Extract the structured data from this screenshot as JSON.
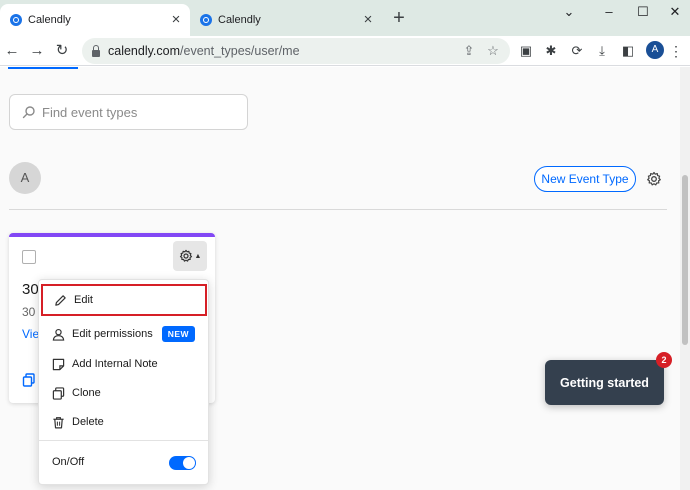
{
  "browser": {
    "tabs": [
      {
        "title": "Calendly"
      },
      {
        "title": "Calendly"
      }
    ],
    "tab_close": "×",
    "new_tab": "+",
    "window_controls": {
      "minimize": "⌄",
      "restore": "–",
      "maximize": "☐",
      "close": "✕"
    },
    "nav": {
      "back": "←",
      "forward": "→",
      "reload": "↻"
    },
    "address": {
      "host": "calendly.com",
      "path": "/event_types/user/me"
    },
    "profile_initial": "A",
    "menu": "⋮"
  },
  "page": {
    "search": {
      "placeholder": "Find event types"
    },
    "user_avatar": "A",
    "new_event_button": "New Event Type",
    "card": {
      "title": "30",
      "subtitle": "30",
      "link": "Vie"
    },
    "menu": {
      "items": [
        {
          "label": "Edit",
          "icon": "pencil-icon"
        },
        {
          "label": "Edit permissions",
          "icon": "person-icon",
          "badge": "NEW"
        },
        {
          "label": "Add Internal Note",
          "icon": "note-icon"
        },
        {
          "label": "Clone",
          "icon": "clone-icon"
        },
        {
          "label": "Delete",
          "icon": "trash-icon"
        }
      ],
      "on_off_label": "On/Off",
      "on_off_state": true
    },
    "getting_started": {
      "label": "Getting started",
      "badge": "2"
    }
  },
  "colors": {
    "brand_blue": "#0069ff",
    "card_accent": "#8247f5",
    "highlight_red": "#d61f26",
    "getting_started_bg": "#34404e"
  }
}
